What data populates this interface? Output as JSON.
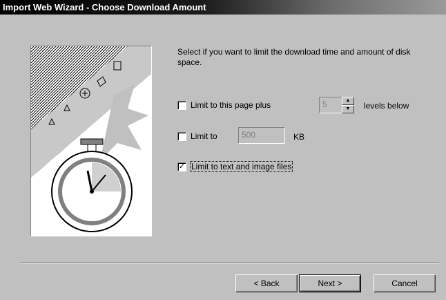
{
  "window": {
    "title": "Import Web Wizard - Choose Download Amount"
  },
  "intro": "Select if you want to limit the download time and amount of disk space.",
  "options": {
    "limit_page": {
      "label": "Limit to this page plus",
      "checked": false,
      "levels_value": "5",
      "suffix": "levels below"
    },
    "limit_kb": {
      "label": "Limit to",
      "checked": false,
      "value": "500",
      "unit": "KB"
    },
    "limit_text_images": {
      "label": "Limit to text and image files",
      "checked": true,
      "mark": "✓"
    }
  },
  "buttons": {
    "back": "< Back",
    "next": "Next >",
    "cancel": "Cancel"
  },
  "icons": {
    "spin_up": "▲",
    "spin_down": "▼"
  }
}
